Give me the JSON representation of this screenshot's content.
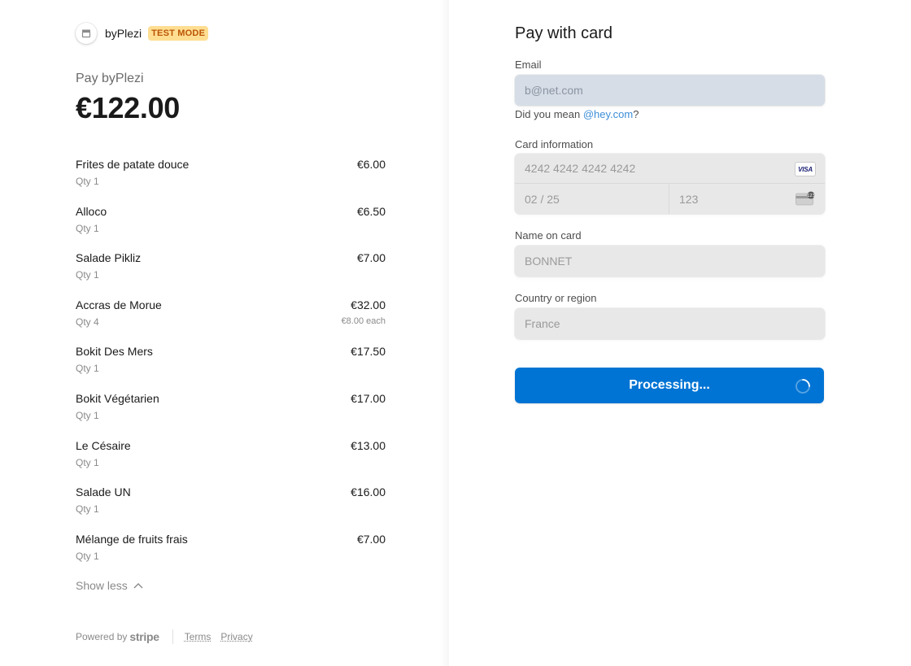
{
  "merchant": {
    "name": "byPlezi",
    "badge": "TEST MODE",
    "pay_label": "Pay byPlezi",
    "total": "€122.00"
  },
  "line_items": [
    {
      "name": "Frites de patate douce",
      "qty": "Qty 1",
      "price": "€6.00",
      "each": ""
    },
    {
      "name": "Alloco",
      "qty": "Qty 1",
      "price": "€6.50",
      "each": ""
    },
    {
      "name": "Salade Pikliz",
      "qty": "Qty 1",
      "price": "€7.00",
      "each": ""
    },
    {
      "name": "Accras de Morue",
      "qty": "Qty 4",
      "price": "€32.00",
      "each": "€8.00 each"
    },
    {
      "name": "Bokit Des Mers",
      "qty": "Qty 1",
      "price": "€17.50",
      "each": ""
    },
    {
      "name": "Bokit Végétarien",
      "qty": "Qty 1",
      "price": "€17.00",
      "each": ""
    },
    {
      "name": "Le Césaire",
      "qty": "Qty 1",
      "price": "€13.00",
      "each": ""
    },
    {
      "name": "Salade UN",
      "qty": "Qty 1",
      "price": "€16.00",
      "each": ""
    },
    {
      "name": "Mélange de fruits frais",
      "qty": "Qty 1",
      "price": "€7.00",
      "each": ""
    }
  ],
  "show_less_label": "Show less",
  "footer": {
    "powered_by": "Powered by",
    "stripe": "stripe",
    "terms": "Terms",
    "privacy": "Privacy"
  },
  "form": {
    "title": "Pay with card",
    "email_label": "Email",
    "email_value": "b@net.com",
    "suggest_prefix": "Did you mean ",
    "suggest_link": "@hey.com",
    "suggest_suffix": "?",
    "card_label": "Card information",
    "card_number": "4242 4242 4242 4242",
    "card_brand": "VISA",
    "card_expiry": "02 / 25",
    "card_cvc": "123",
    "name_label": "Name on card",
    "name_value": "BONNET",
    "country_label": "Country or region",
    "country_value": "France",
    "button_label": "Processing..."
  },
  "colors": {
    "accent": "#0074d4",
    "badge_bg": "#ffde92",
    "badge_text": "#bb5504",
    "link": "#3d8ed8"
  },
  "icons": {
    "merchant": "store-icon",
    "show_less": "chevron-up-icon",
    "card_brand": "visa-icon",
    "cvc": "cvc-card-icon",
    "spinner": "spinner-icon"
  }
}
